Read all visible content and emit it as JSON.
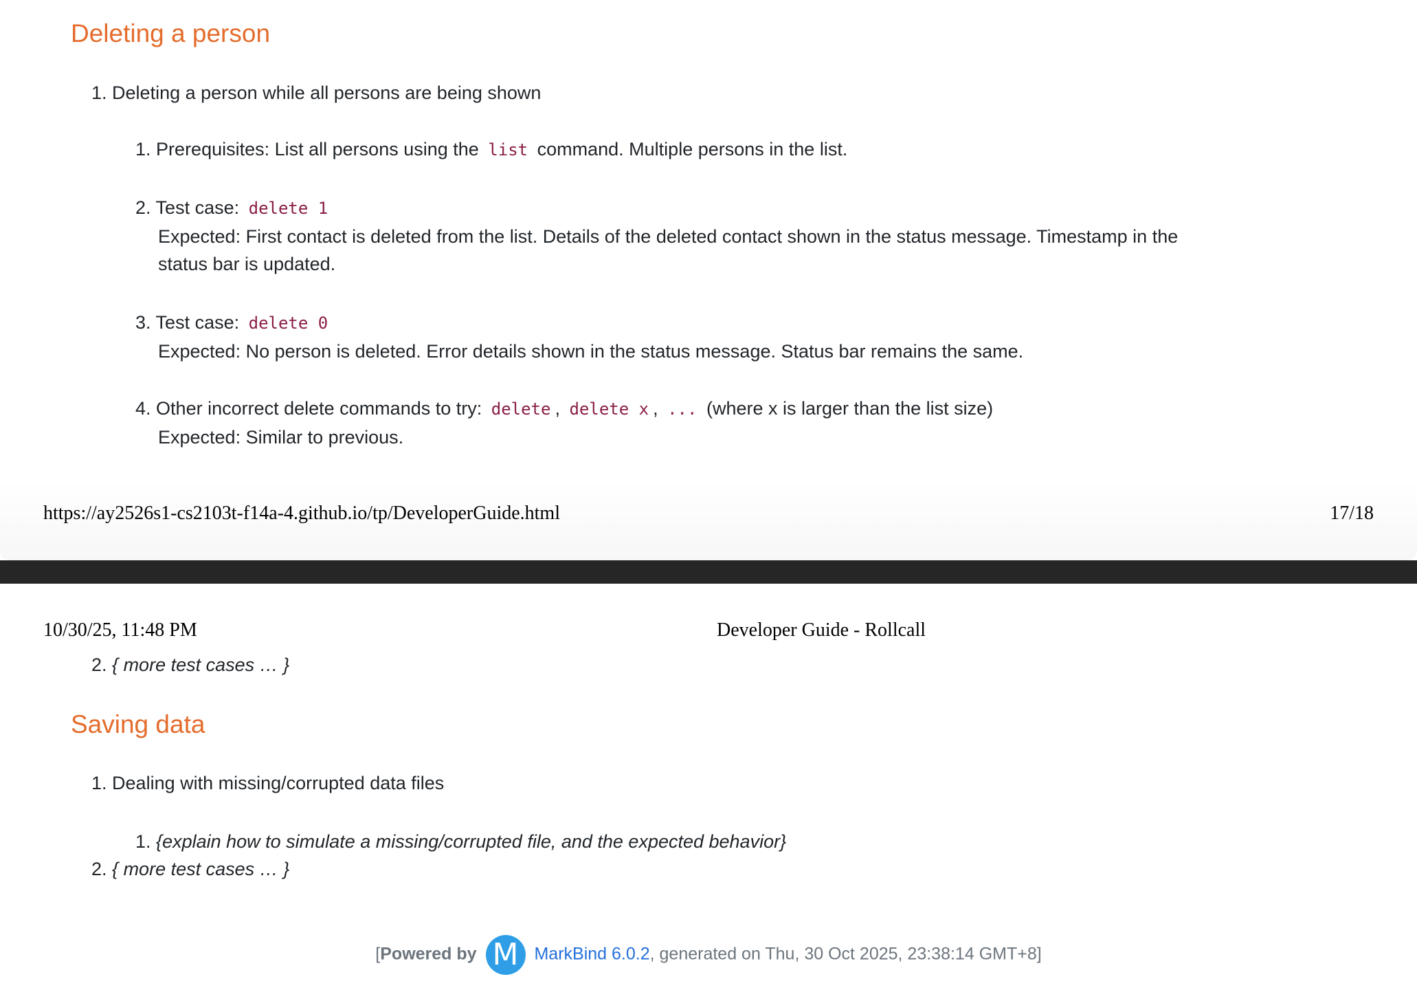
{
  "page1": {
    "heading": "Deleting a person",
    "item1": {
      "num": "1.",
      "text": "Deleting a person while all persons are being shown"
    },
    "sub1": {
      "num": "1.",
      "text_before": "Prerequisites: List all persons using the",
      "code": "list",
      "text_after": "command. Multiple persons in the list."
    },
    "sub2": {
      "num": "2.",
      "text_before": "Test case:",
      "code": "delete 1",
      "expected_line1": "Expected: First contact is deleted from the list. Details of the deleted contact shown in the status message. Timestamp in the",
      "expected_line2": "status bar is updated."
    },
    "sub3": {
      "num": "3.",
      "text_before": "Test case:",
      "code": "delete 0",
      "expected": "Expected: No person is deleted. Error details shown in the status message. Status bar remains the same."
    },
    "sub4": {
      "num": "4.",
      "text_before": "Other incorrect delete commands to try:",
      "code1": "delete",
      "sep1": ",",
      "code2": "delete x",
      "sep2": ",",
      "code3": "...",
      "text_after": "(where x is larger than the list size)",
      "expected": "Expected: Similar to previous."
    },
    "print_url": "https://ay2526s1-cs2103t-f14a-4.github.io/tp/DeveloperGuide.html",
    "page_number": "17/18"
  },
  "page2": {
    "print_datetime": "10/30/25, 11:48 PM",
    "print_title": "Developer Guide - Rollcall",
    "more1": {
      "num": "2.",
      "text": "{ more test cases … }"
    },
    "heading": "Saving data",
    "item1": {
      "num": "1.",
      "text": "Dealing with missing/corrupted data files"
    },
    "sub1": {
      "num": "1.",
      "text": "{explain how to simulate a missing/corrupted file, and the expected behavior}"
    },
    "more2": {
      "num": "2.",
      "text": "{ more test cases … }"
    }
  },
  "footer": {
    "open_bracket": "[",
    "powered_by": "Powered by",
    "logo_letter": "M",
    "markbind_link": "MarkBind 6.0.2",
    "generated_text": ", generated on Thu, 30 Oct 2025, 23:38:14 GMT+8]"
  },
  "colors": {
    "heading": "#e46c2c",
    "code": "#8a1d46",
    "link": "#2470dc",
    "logo": "#2f9ee6",
    "separator": "#262626"
  }
}
